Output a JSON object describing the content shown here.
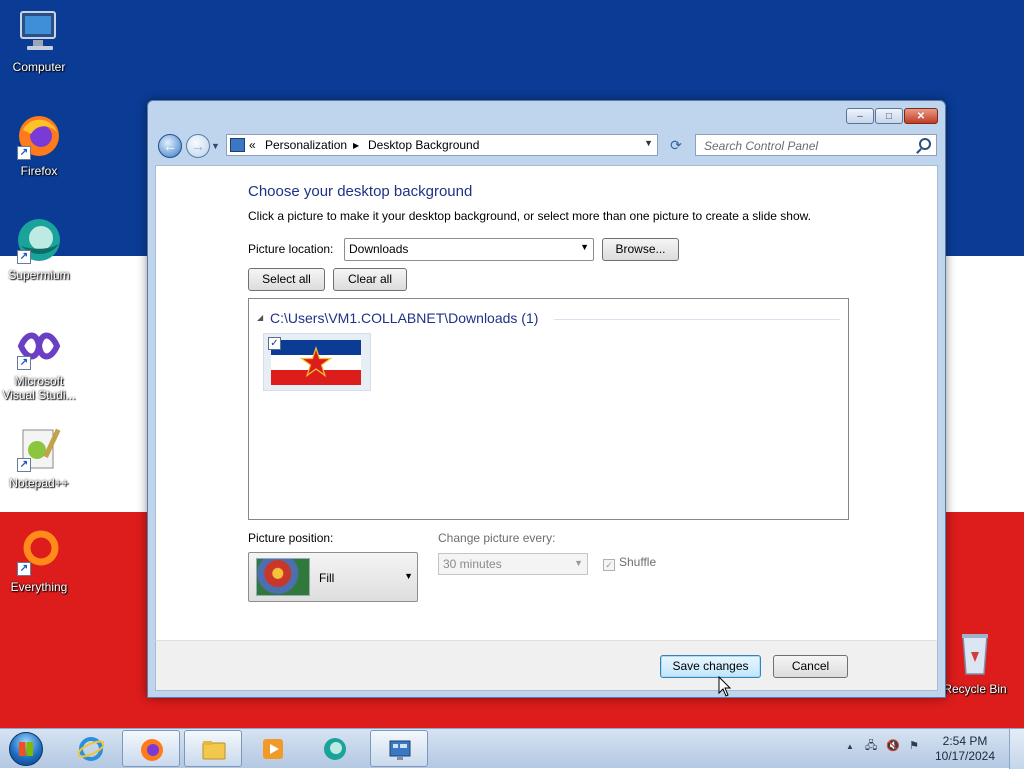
{
  "desktop": {
    "icons": [
      {
        "name": "computer",
        "label": "Computer"
      },
      {
        "name": "firefox",
        "label": "Firefox"
      },
      {
        "name": "supermium",
        "label": "Supermium"
      },
      {
        "name": "visual-studio",
        "label": "Microsoft Visual Studi..."
      },
      {
        "name": "notepadpp",
        "label": "Notepad++"
      },
      {
        "name": "everything",
        "label": "Everything"
      },
      {
        "name": "recycle-bin",
        "label": "Recycle Bin"
      }
    ],
    "wallpaper_colors": [
      "#0a3c96",
      "#ffffff",
      "#dd1c1c"
    ]
  },
  "window": {
    "controls": {
      "minimize": "–",
      "maximize": "□",
      "close": "✕"
    },
    "breadcrumb": {
      "overflow": "«",
      "items": [
        "Personalization",
        "Desktop Background"
      ],
      "separator": "▶"
    },
    "search_placeholder": "Search Control Panel",
    "heading": "Choose your desktop background",
    "description": "Click a picture to make it your desktop background, or select more than one picture to create a slide show.",
    "picture_location": {
      "label": "Picture location:",
      "value": "Downloads"
    },
    "browse_label": "Browse...",
    "select_all_label": "Select all",
    "clear_all_label": "Clear all",
    "group": {
      "header": "C:\\Users\\VM1.COLLABNET\\Downloads (1)",
      "images": [
        {
          "checked": true,
          "icon": "yugoslav-flag"
        }
      ]
    },
    "picture_position": {
      "label": "Picture position:",
      "value": "Fill"
    },
    "change_picture": {
      "label": "Change picture every:",
      "value": "30 minutes",
      "enabled": false
    },
    "shuffle": {
      "label": "Shuffle",
      "checked": true,
      "enabled": false
    },
    "save_label": "Save changes",
    "cancel_label": "Cancel"
  },
  "taskbar": {
    "pinned": [
      "internet-explorer",
      "firefox",
      "explorer",
      "media-player",
      "supermium",
      "control-panel"
    ],
    "active": [
      "firefox",
      "control-panel"
    ],
    "clock_time": "2:54 PM",
    "clock_date": "10/17/2024",
    "tray_arrow": "▲"
  },
  "colors": {
    "accent_heading": "#1e3287",
    "window_frame": "#bfd4ed"
  }
}
